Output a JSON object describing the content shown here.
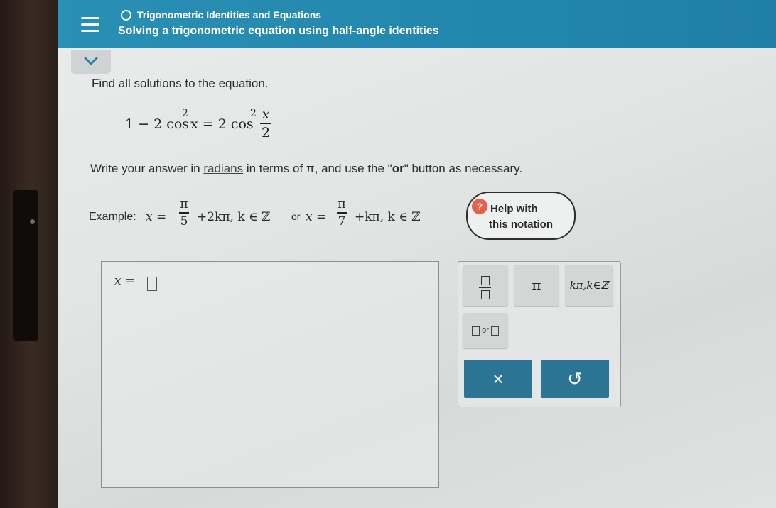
{
  "header": {
    "topic": "Trigonometric Identities and Equations",
    "subtitle": "Solving a trigonometric equation using half-angle identities"
  },
  "problem": {
    "prompt": "Find all solutions to the equation.",
    "equation": {
      "lhs": "1 − 2 cos",
      "sup1": "2",
      "mid": "x = 2 cos",
      "sup2": "2",
      "frac_num": "x",
      "frac_den": "2"
    },
    "instruction_pre": "Write your answer in ",
    "instruction_link": "radians",
    "instruction_mid": " in terms of π, and use the \"",
    "instruction_bold": "or",
    "instruction_post": "\" button as necessary."
  },
  "example": {
    "label": "Example:",
    "x1": "x =",
    "num1": "π",
    "den1": "5",
    "rest1": "+2kπ, k ∈ ℤ",
    "or": "or",
    "x2": "x =",
    "num2": "π",
    "den2": "7",
    "rest2": "+kπ, k ∈ ℤ"
  },
  "help": {
    "line1": "Help with",
    "line2": "this notation",
    "bulb": "?"
  },
  "answer": {
    "prefix": "x ="
  },
  "keypad": {
    "pi": "π",
    "k_set": "kπ,k∈ℤ",
    "or_label": "or",
    "clear": "×",
    "undo": "↺"
  }
}
